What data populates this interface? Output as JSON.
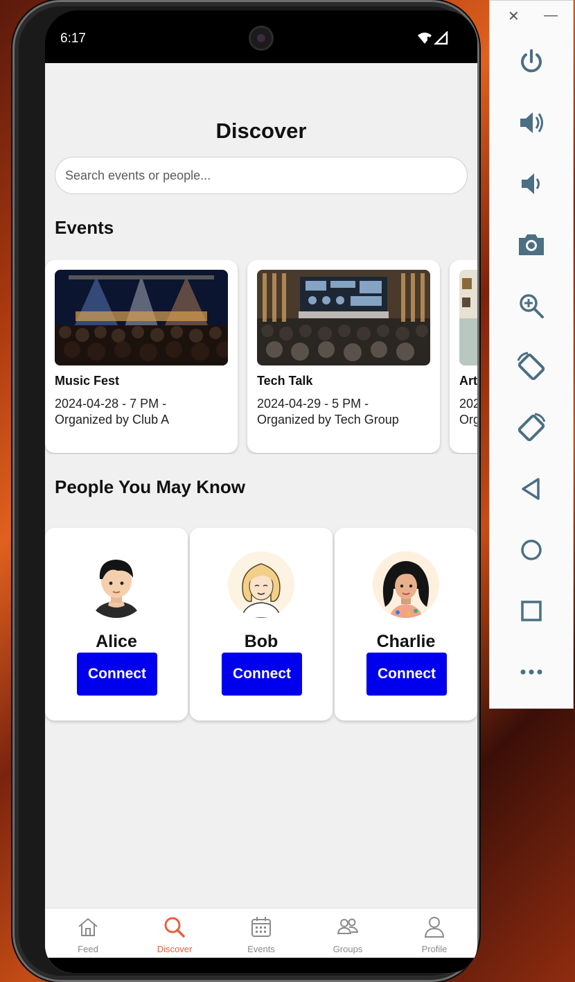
{
  "status": {
    "time": "6:17"
  },
  "page": {
    "title": "Discover"
  },
  "search": {
    "placeholder": "Search events or people..."
  },
  "events_section": {
    "title": "Events",
    "items": [
      {
        "name": "Music Fest",
        "datetime": "2024-04-28 - 7 PM -",
        "organizer": "Organized by Club A"
      },
      {
        "name": "Tech Talk",
        "datetime": "2024-04-29 - 5 PM -",
        "organizer": "Organized by Tech Group"
      },
      {
        "name": "Art",
        "datetime": "202",
        "organizer": "Org"
      }
    ]
  },
  "people_section": {
    "title": "People You May Know",
    "items": [
      {
        "name": "Alice",
        "action": "Connect"
      },
      {
        "name": "Bob",
        "action": "Connect"
      },
      {
        "name": "Charlie",
        "action": "Connect"
      }
    ]
  },
  "tabbar": {
    "items": [
      {
        "label": "Feed",
        "icon": "home-icon"
      },
      {
        "label": "Discover",
        "icon": "search-icon",
        "active": true
      },
      {
        "label": "Events",
        "icon": "calendar-icon"
      },
      {
        "label": "Groups",
        "icon": "groups-icon"
      },
      {
        "label": "Profile",
        "icon": "person-icon"
      }
    ]
  },
  "emulator": {
    "buttons": [
      "power",
      "volume-up",
      "volume-down",
      "screenshot",
      "zoom",
      "rotate-left",
      "rotate-right",
      "back",
      "home",
      "overview",
      "more"
    ]
  },
  "colors": {
    "accent": "#e8603c",
    "connect": "#0000ee",
    "background": "#f0f0f0"
  }
}
